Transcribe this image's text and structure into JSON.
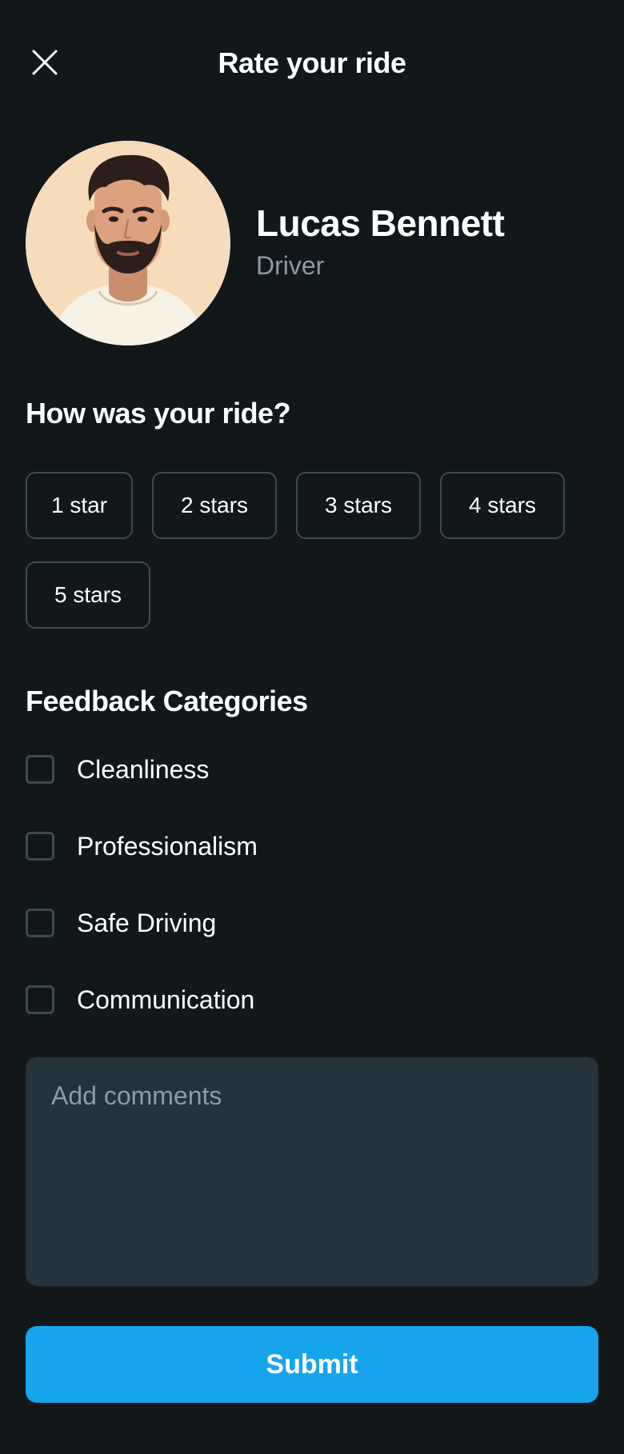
{
  "header": {
    "title": "Rate your ride",
    "close_icon": "close-icon"
  },
  "driver": {
    "name": "Lucas Bennett",
    "role": "Driver",
    "avatar": "avatar-illustration"
  },
  "rating": {
    "question": "How was your ride?",
    "options": [
      "1 star",
      "2 stars",
      "3 stars",
      "4 stars",
      "5 stars"
    ]
  },
  "feedback": {
    "title": "Feedback Categories",
    "categories": [
      {
        "label": "Cleanliness",
        "checked": false
      },
      {
        "label": "Professionalism",
        "checked": false
      },
      {
        "label": "Safe Driving",
        "checked": false
      },
      {
        "label": "Communication",
        "checked": false
      }
    ]
  },
  "comments": {
    "placeholder": "Add comments",
    "value": ""
  },
  "submit": {
    "label": "Submit"
  },
  "colors": {
    "background": "#12171a",
    "accent": "#16a4ec",
    "border": "#3d4a52",
    "input_bg": "#263239",
    "muted_text": "#8c9aa6"
  }
}
